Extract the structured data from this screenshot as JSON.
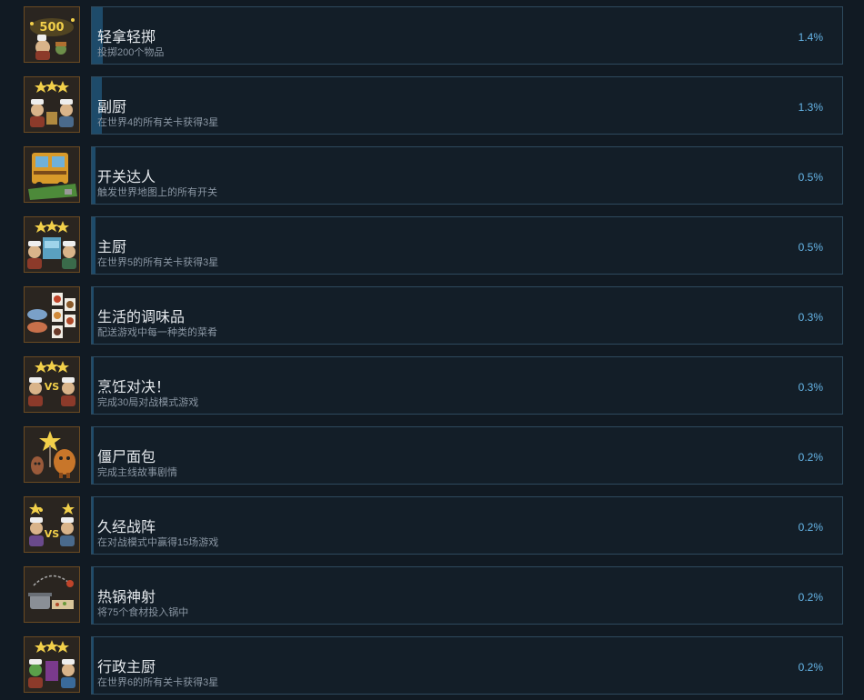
{
  "colors": {
    "background": "#111a23",
    "panel_border": "#2e4a5e",
    "progress_fill": "#1e4b6a",
    "percent_text": "#66b6e8",
    "icon_border": "#6a4a22"
  },
  "achievements": [
    {
      "icon": "throw-items-500-icon",
      "title": "轻拿轻掷",
      "description": "投掷200个物品",
      "percent": "1.4%",
      "progress": 1.4
    },
    {
      "icon": "sous-chef-three-stars-icon",
      "title": "副厨",
      "description": "在世界4的所有关卡获得3星",
      "percent": "1.3%",
      "progress": 1.3
    },
    {
      "icon": "food-truck-switch-icon",
      "title": "开关达人",
      "description": "触发世界地图上的所有开关",
      "percent": "0.5%",
      "progress": 0.5
    },
    {
      "icon": "head-chef-three-stars-icon",
      "title": "主厨",
      "description": "在世界5的所有关卡获得3星",
      "percent": "0.5%",
      "progress": 0.5
    },
    {
      "icon": "dish-cards-icon",
      "title": "生活的调味品",
      "description": "配送游戏中每一种类的菜肴",
      "percent": "0.3%",
      "progress": 0.3
    },
    {
      "icon": "cook-off-vs-icon",
      "title": "烹饪对决！",
      "description": "完成30局对战模式游戏",
      "percent": "0.3%",
      "progress": 0.3
    },
    {
      "icon": "zombie-bread-icon",
      "title": "僵尸面包",
      "description": "完成主线故事剧情",
      "percent": "0.2%",
      "progress": 0.2
    },
    {
      "icon": "veteran-vs-icon",
      "title": "久经战阵",
      "description": "在对战模式中赢得15场游戏",
      "percent": "0.2%",
      "progress": 0.2
    },
    {
      "icon": "hot-pot-shot-icon",
      "title": "热锅神射",
      "description": "将75个食材投入锅中",
      "percent": "0.2%",
      "progress": 0.2
    },
    {
      "icon": "executive-chef-three-stars-icon",
      "title": "行政主厨",
      "description": "在世界6的所有关卡获得3星",
      "percent": "0.2%",
      "progress": 0.2
    }
  ]
}
